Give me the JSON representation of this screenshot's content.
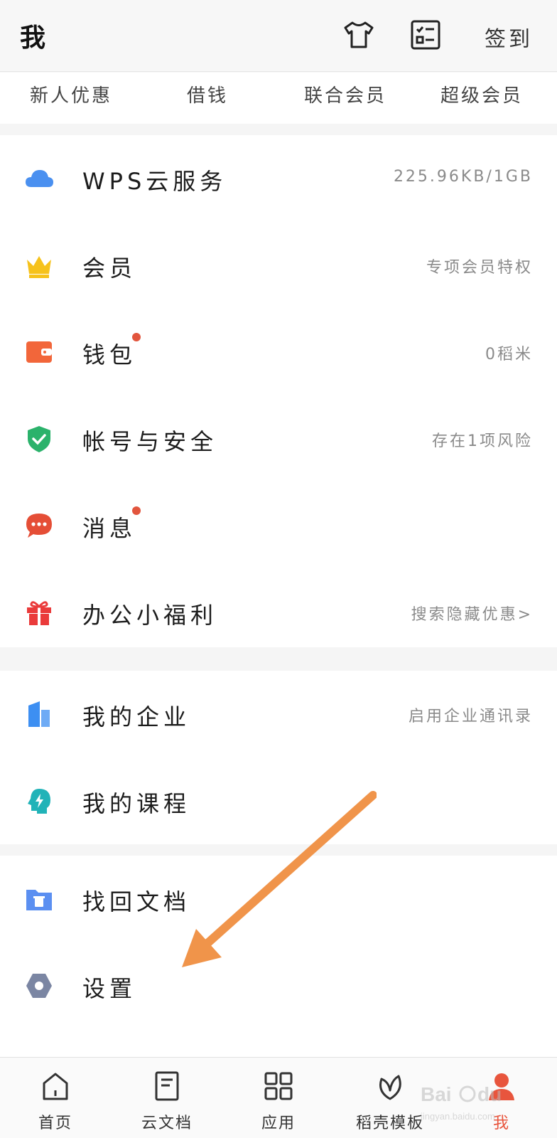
{
  "colors": {
    "accent": "#e8553d",
    "cloud": "#4a90f0",
    "crown": "#f6c21c",
    "wallet": "#f2663a",
    "shield": "#2bb26b",
    "message": "#e54e36",
    "gift": "#ea3b3b",
    "enterprise": "#3d8ff2",
    "course": "#21b3b8",
    "recover": "#5b8ff1",
    "settings": "#7b86a3",
    "arrow": "#f0944a"
  },
  "header": {
    "title": "我",
    "icons": [
      "tshirt-icon",
      "checklist-icon"
    ],
    "checkin_label": "签到"
  },
  "quick_links": [
    "新人优惠",
    "借钱",
    "联合会员",
    "超级会员"
  ],
  "section1": [
    {
      "icon": "cloud-icon",
      "label": "WPS云服务",
      "value": "225.96KB/1GB",
      "dot": false
    },
    {
      "icon": "crown-icon",
      "label": "会员",
      "value": "专项会员特权",
      "dot": false
    },
    {
      "icon": "wallet-icon",
      "label": "钱包",
      "value": "0稻米",
      "dot": true
    },
    {
      "icon": "shield-icon",
      "label": "帐号与安全",
      "value": "存在1项风险",
      "dot": false
    },
    {
      "icon": "message-icon",
      "label": "消息",
      "value": "",
      "dot": true
    },
    {
      "icon": "gift-icon",
      "label": "办公小福利",
      "value": "搜索隐藏优惠>",
      "dot": false
    }
  ],
  "section2": [
    {
      "icon": "enterprise-icon",
      "label": "我的企业",
      "value": "启用企业通讯录"
    },
    {
      "icon": "course-icon",
      "label": "我的课程",
      "value": ""
    }
  ],
  "section3": [
    {
      "icon": "recover-folder-icon",
      "label": "找回文档",
      "value": ""
    },
    {
      "icon": "settings-hex-icon",
      "label": "设置",
      "value": ""
    }
  ],
  "bottom_nav": [
    {
      "icon": "home-icon",
      "label": "首页",
      "active": false
    },
    {
      "icon": "cloud-doc-icon",
      "label": "云文档",
      "active": false
    },
    {
      "icon": "apps-grid-icon",
      "label": "应用",
      "active": false
    },
    {
      "icon": "leaf-icon",
      "label": "稻壳模板",
      "active": false
    },
    {
      "icon": "profile-icon",
      "label": "我",
      "active": true
    }
  ],
  "watermark": {
    "brand": "Baidu经验",
    "url": "jingyan.baidu.com"
  }
}
